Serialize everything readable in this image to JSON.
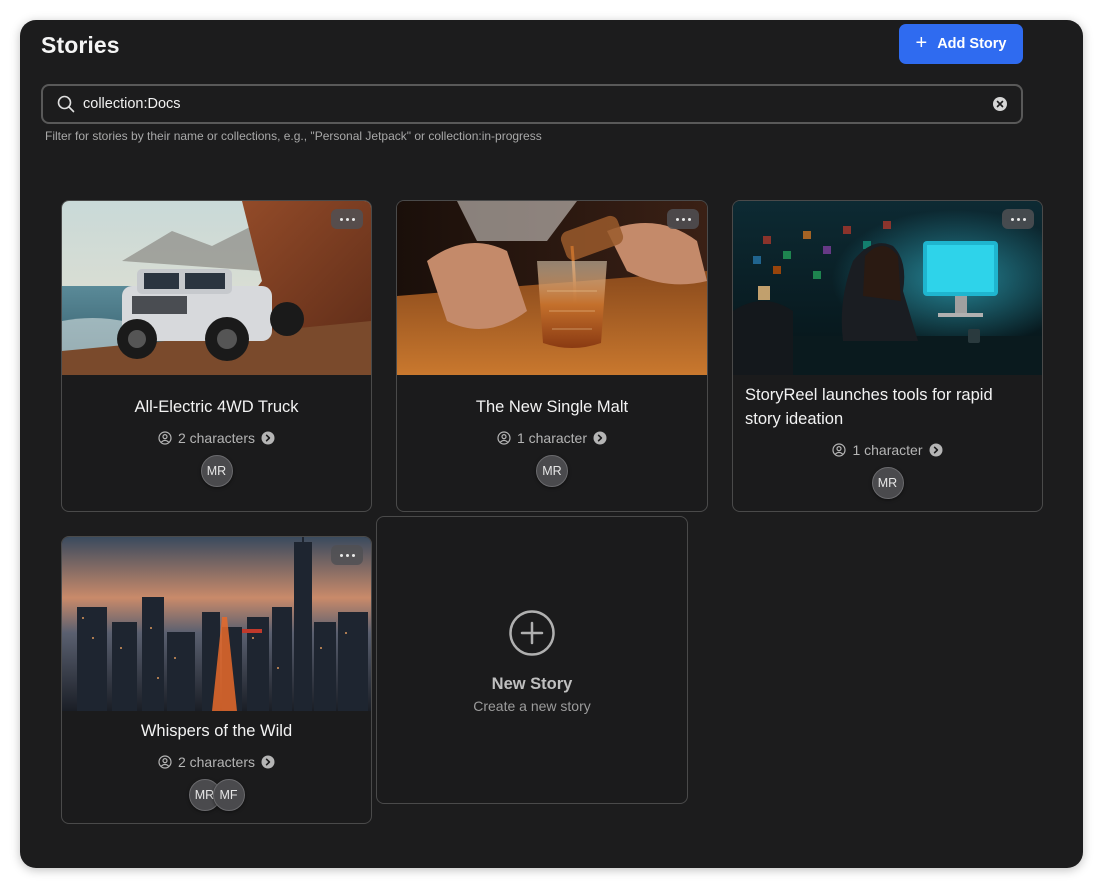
{
  "header": {
    "title": "Stories",
    "add_button_label": "Add Story",
    "add_button_icon": "plus-icon",
    "accent_color": "#2f6bf0"
  },
  "search": {
    "value": "collection:Docs",
    "placeholder": "Search stories",
    "hint": "Filter for stories by their name or collections, e.g., \"Personal Jetpack\" or collection:in-progress",
    "icon": "search-icon",
    "clear_icon": "clear-icon"
  },
  "stories": [
    {
      "title": "All-Electric 4WD Truck",
      "characters": "2 characters",
      "avatars": [
        "MR"
      ],
      "image": "pickup truck on coastal cliff road"
    },
    {
      "title": "The New Single Malt",
      "characters": "1 character",
      "avatars": [
        "MR"
      ],
      "image": "whisky poured into glass"
    },
    {
      "title": "StoryReel launches tools for rapid story ideation",
      "characters": "1 character",
      "avatars": [
        "MR"
      ],
      "image": "woman working at computer at night"
    },
    {
      "title": "Whispers of the Wild",
      "characters": "2 characters",
      "avatars": [
        "MR",
        "MF"
      ],
      "image": "city skyline at dusk"
    }
  ],
  "new_story": {
    "title": "New Story",
    "subtitle": "Create a new story",
    "icon": "plus-circle-icon"
  }
}
